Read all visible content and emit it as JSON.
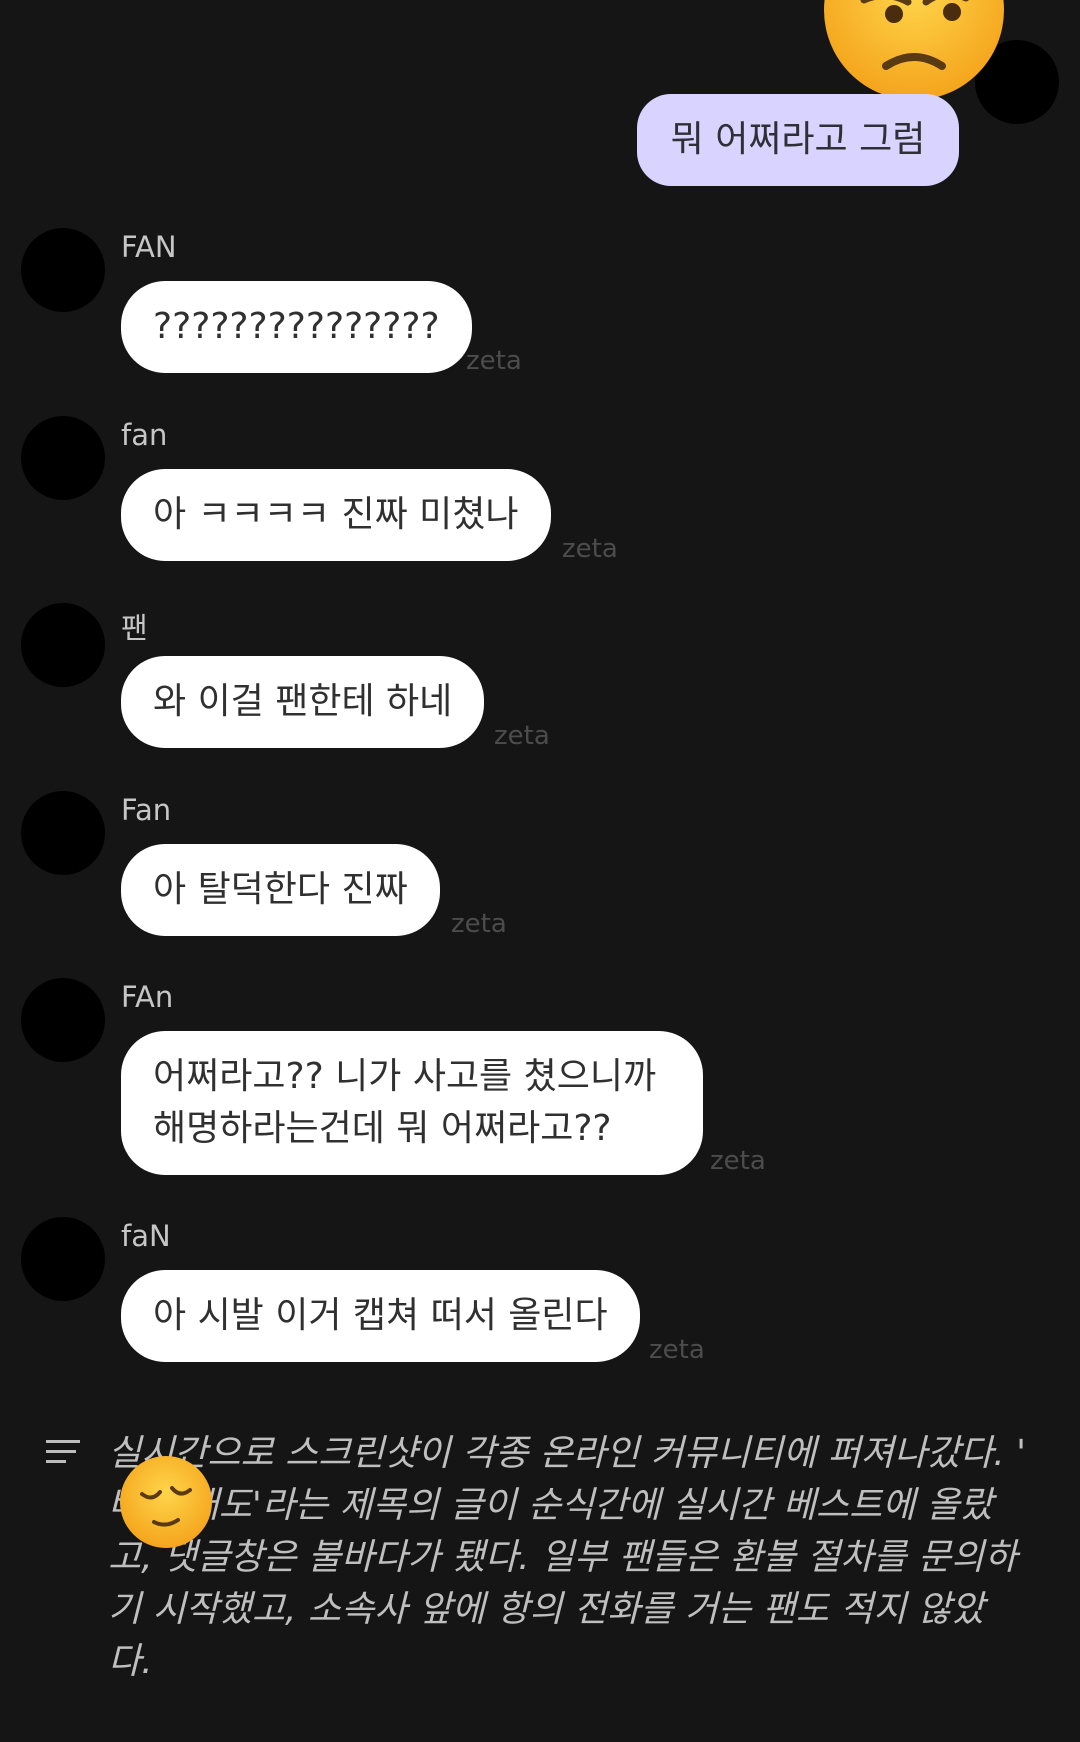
{
  "my_message": {
    "text": "뭐 어쩌라고 그럼",
    "emoji": "annoyed-face-icon",
    "bubble_color": "#d9d3ff"
  },
  "messages": [
    {
      "name": "FAN",
      "text": "???????????????",
      "tag": "zeta"
    },
    {
      "name": "fan",
      "text": "아 ㅋㅋㅋㅋ 진짜 미쳤나",
      "tag": "zeta"
    },
    {
      "name": "팬",
      "text": "와 이걸 팬한테 하네",
      "tag": "zeta"
    },
    {
      "name": "Fan",
      "text": "아 탈덕한다 진짜",
      "tag": "zeta"
    },
    {
      "name": "FAn",
      "text": "어쩌라고?? 니가 사고를 쳤으니까 해명하라는건데 뭐 어쩌라고??",
      "tag": "zeta"
    },
    {
      "name": "faN",
      "text": "아 시발 이거 캡쳐 떠서 올린다",
      "tag": "zeta"
    }
  ],
  "narration": {
    "icon": "menu-icon",
    "emoji": "sleepy-face-icon",
    "text": "실시간으로 스크린샷이 각종 온라인 커뮤니티에 퍼져나갔다. '　　 버블 태도'라는 제목의 글이 순식간에 실시간 베스트에 올랐고, 댓글창은 불바다가 됐다. 일부 팬들은 환불 절차를 문의하기 시작했고, 소속사 앞에 항의 전화를 거는 팬도 적지 않았다."
  },
  "colors": {
    "background": "#151515",
    "bubble": "#ffffff",
    "tag": "#4c4c4c"
  }
}
